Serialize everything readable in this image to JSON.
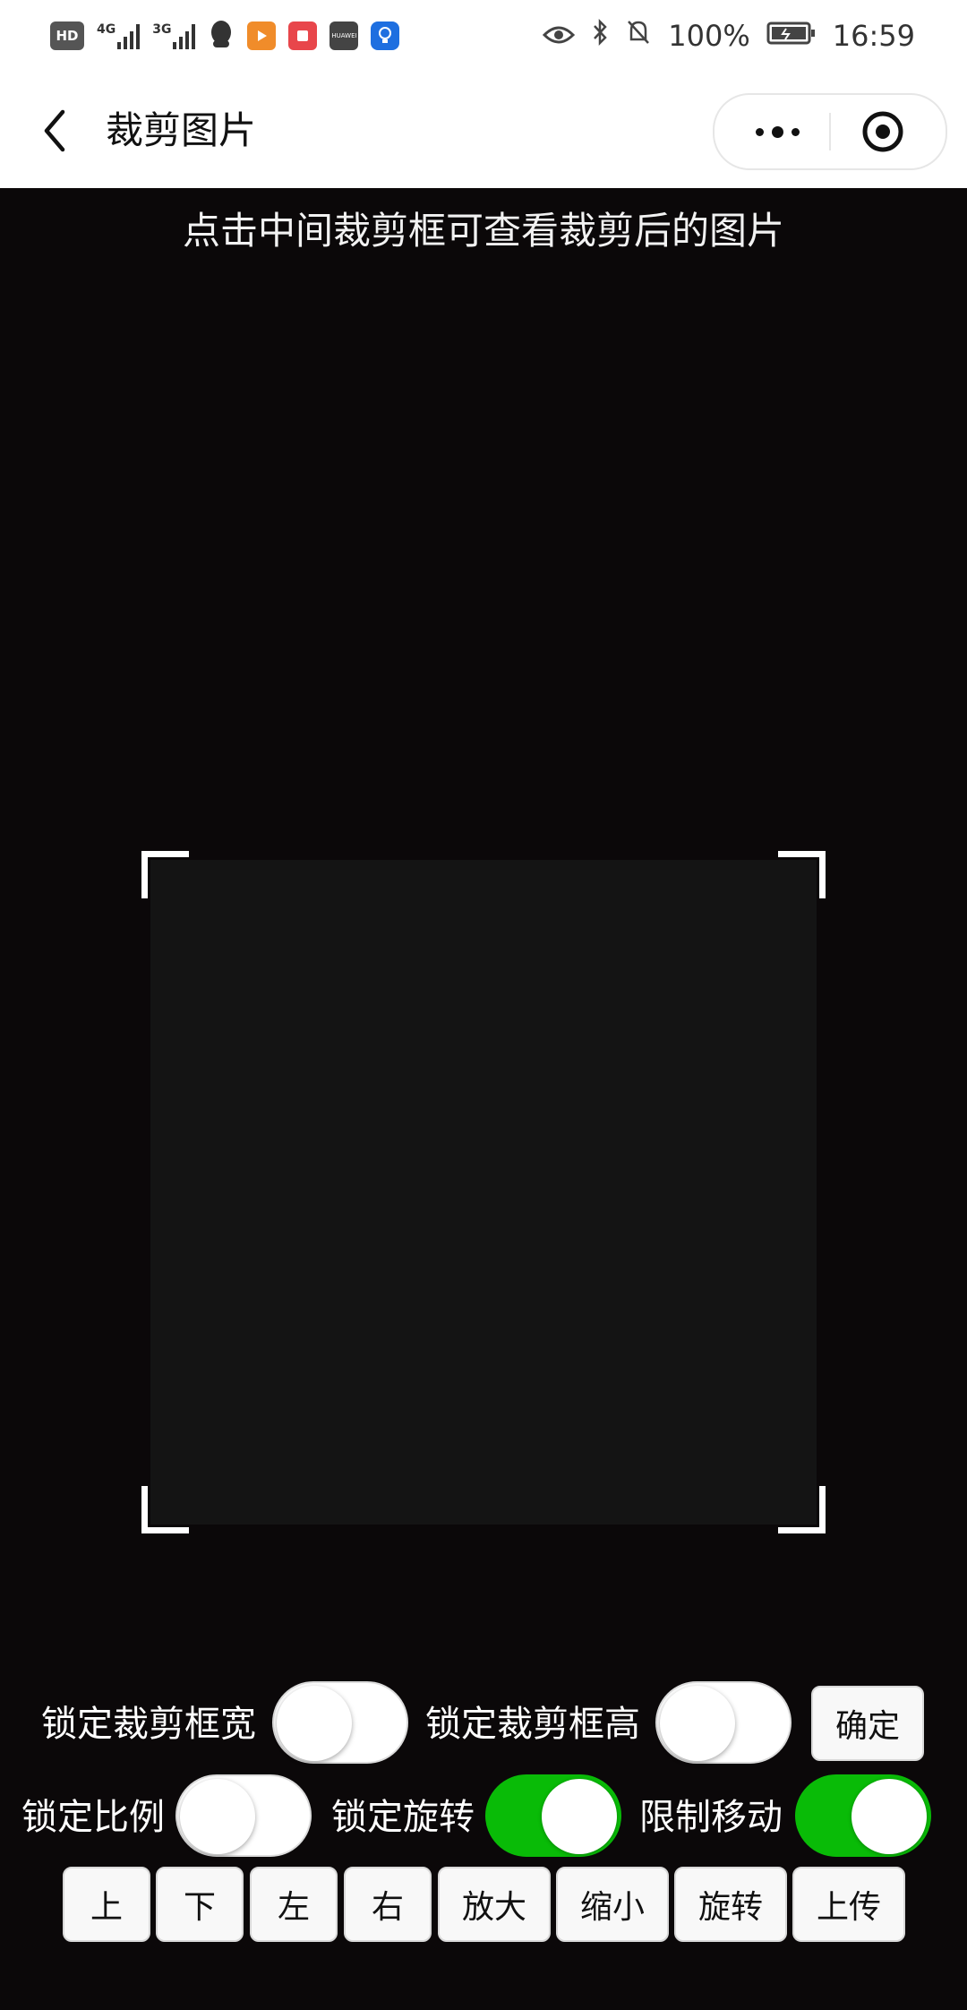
{
  "status_bar": {
    "left_icons": [
      "hd-icon",
      "signal-4g-icon",
      "signal-3g-icon",
      "qq-icon",
      "video-app-icon",
      "book-app-icon",
      "huawei-app-icon",
      "bulb-app-icon"
    ],
    "network_4g": "4G",
    "network_3g": "3G",
    "hd": "HD",
    "huawei_label": "HUAWEI",
    "battery": "100%",
    "time": "16:59"
  },
  "nav": {
    "title": "裁剪图片"
  },
  "hint": "点击中间裁剪框可查看裁剪后的图片",
  "controls": {
    "lock_width_label": "锁定裁剪框宽",
    "lock_width_on": false,
    "lock_height_label": "锁定裁剪框高",
    "lock_height_on": false,
    "confirm_label": "确定",
    "lock_ratio_label": "锁定比例",
    "lock_ratio_on": false,
    "lock_rotate_label": "锁定旋转",
    "lock_rotate_on": true,
    "limit_move_label": "限制移动",
    "limit_move_on": true
  },
  "buttons": {
    "up": "上",
    "down": "下",
    "left": "左",
    "right": "右",
    "zoom_in": "放大",
    "zoom_out": "缩小",
    "rotate": "旋转",
    "upload": "上传"
  },
  "colors": {
    "switch_on": "#09bb07",
    "background": "#0b0809"
  }
}
